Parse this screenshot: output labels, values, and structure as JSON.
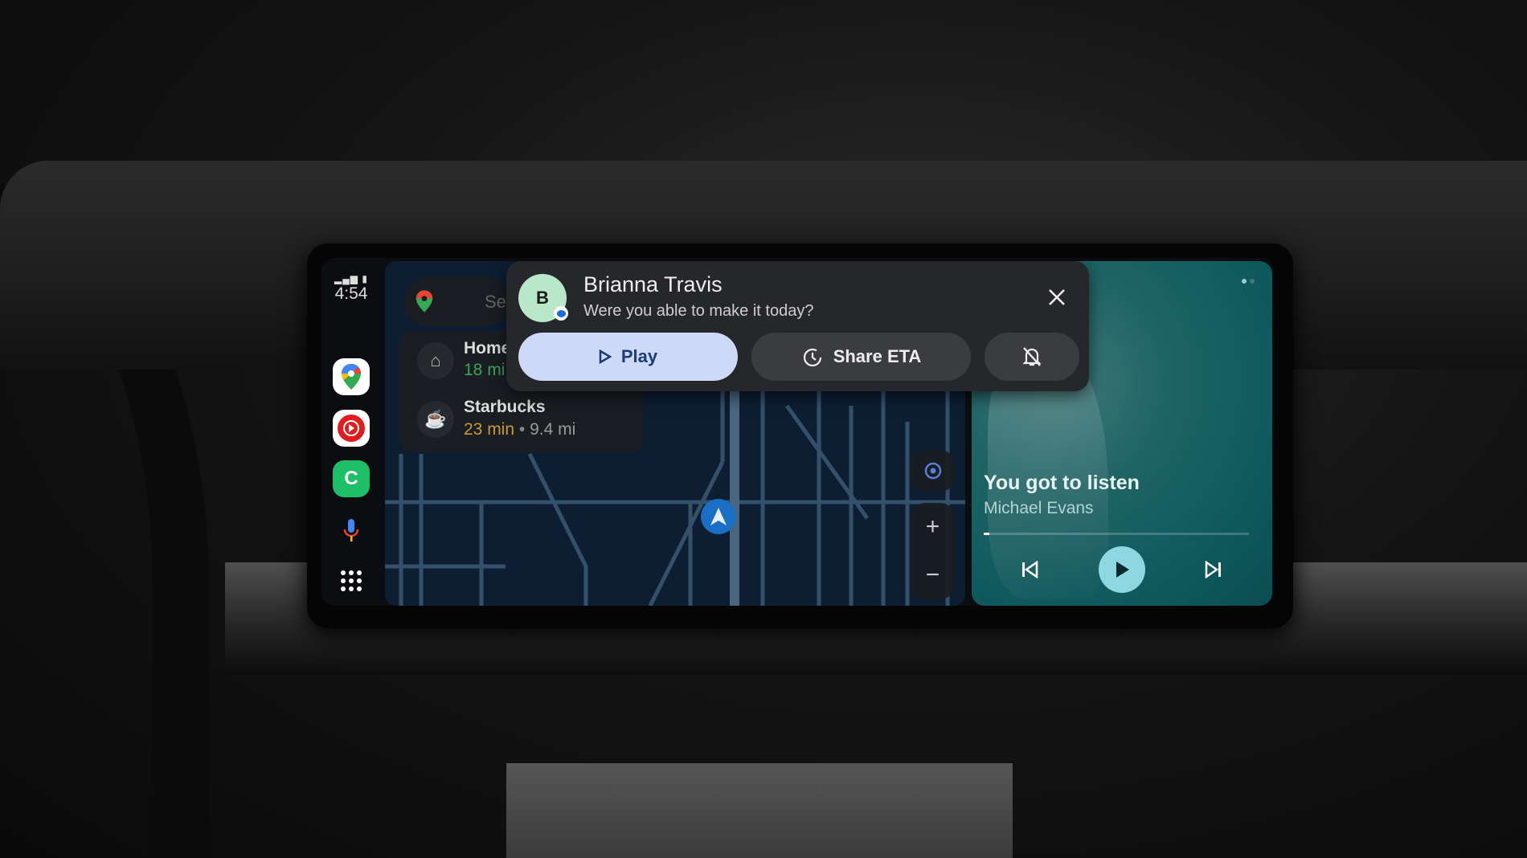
{
  "status": {
    "time": "4:54",
    "signal-icon": "signal-icon",
    "battery-icon": "battery-icon"
  },
  "rail": {
    "apps": [
      {
        "name": "Google Maps",
        "icon": "maps-icon"
      },
      {
        "name": "YouTube Music",
        "icon": "youtube-music-icon"
      },
      {
        "name": "Phone",
        "icon": "phone-icon"
      },
      {
        "name": "Assistant",
        "icon": "mic-icon"
      },
      {
        "name": "App launcher",
        "icon": "grid-icon"
      }
    ]
  },
  "map": {
    "search_placeholder": "Se",
    "suggestions": [
      {
        "title": "Home",
        "eta": "18 mi",
        "icon": "home-icon"
      },
      {
        "title": "Starbucks",
        "eta": "23 min",
        "distance": "9.4 mi",
        "separator": "•",
        "icon": "coffee-icon"
      }
    ]
  },
  "notification": {
    "avatar_letter": "B",
    "sender": "Brianna Travis",
    "message": "Were you able to make it today?",
    "play_label": "Play",
    "share_eta_label": "Share ETA",
    "colors": {
      "play_bg": "#cdd9f7",
      "avatar_bg": "#b8e7c9"
    }
  },
  "media": {
    "title": "You got to listen",
    "artist": "Michael Evans",
    "progress": 0.02,
    "accent": "#8fd7e0"
  }
}
